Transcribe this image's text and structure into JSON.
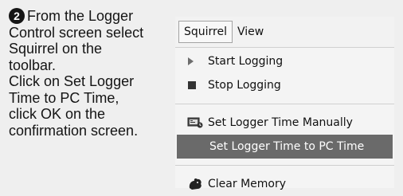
{
  "instructions": {
    "step_number": "2",
    "lines": [
      "From the Logger",
      "Control screen select",
      "Squirrel on the",
      "toolbar.",
      "Click on Set Logger",
      "Time to PC Time,",
      "click OK on the",
      "confirmation screen."
    ]
  },
  "menubar": {
    "items": [
      "Squirrel",
      "View"
    ]
  },
  "menu": {
    "items": [
      {
        "label": "Start Logging",
        "icon": "play-arrow-icon"
      },
      {
        "label": "Stop Logging",
        "icon": "stop-square-icon"
      },
      {
        "label": "Set Logger Time Manually",
        "icon": "set-time-icon"
      },
      {
        "label": "Set Logger Time to PC Time",
        "icon": "",
        "highlighted": true
      },
      {
        "label": "Clear Memory",
        "icon": "squirrel-icon"
      }
    ]
  },
  "colors": {
    "highlight": "#6a6a6a",
    "background": "#efefef"
  }
}
